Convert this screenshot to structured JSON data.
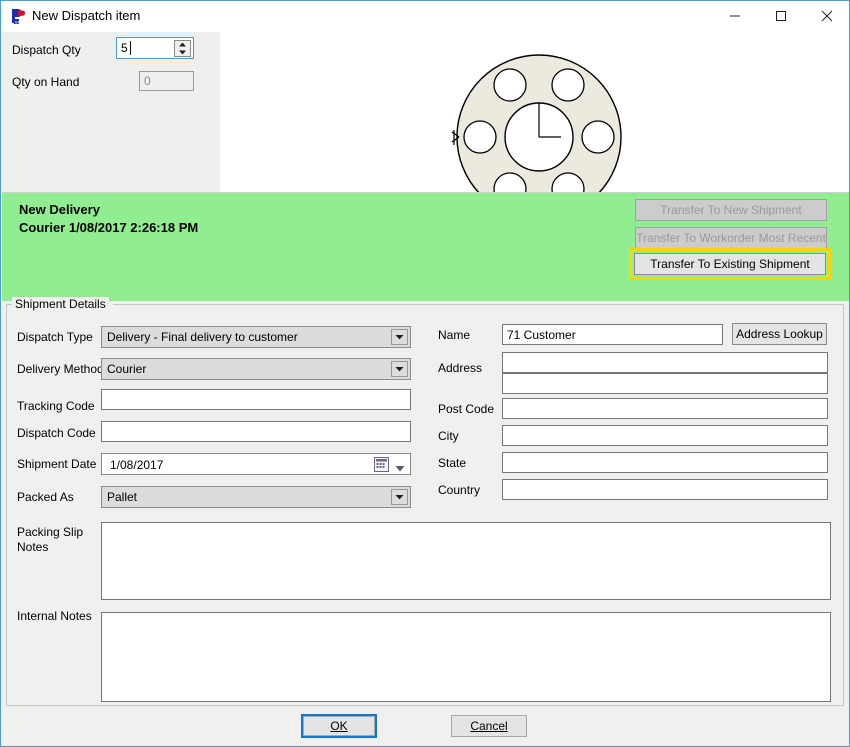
{
  "window": {
    "title": "New Dispatch item",
    "app_icon": "p-logo-icon",
    "controls": {
      "minimize": "minimize-icon",
      "maximize": "maximize-icon",
      "close": "close-icon"
    }
  },
  "top_panel": {
    "dispatch_qty_label": "Dispatch Qty",
    "dispatch_qty_value": "5",
    "qty_on_hand_label": "Qty on Hand",
    "qty_on_hand_value": "0"
  },
  "part_drawing": {
    "name": "flange-part-drawing",
    "description": "Circular flange with six bolt holes and central bore"
  },
  "delivery_banner": {
    "title": "New Delivery",
    "subtitle": "Courier 1/08/2017 2:26:18 PM",
    "background_color": "#90ee90",
    "buttons": [
      {
        "label": "Transfer To New Shipment",
        "enabled": false
      },
      {
        "label": "Transfer To Workorder Most Recent",
        "enabled": false
      },
      {
        "label": "Transfer To Existing Shipment",
        "enabled": true,
        "highlight_color": "#ffd400"
      }
    ]
  },
  "shipment_details": {
    "group_label": "Shipment Details",
    "dispatch_type": {
      "label": "Dispatch Type",
      "value": "Delivery - Final delivery to customer"
    },
    "delivery_method": {
      "label": "Delivery Method",
      "value": "Courier"
    },
    "tracking_code": {
      "label": "Tracking Code",
      "value": ""
    },
    "dispatch_code": {
      "label": "Dispatch Code",
      "value": ""
    },
    "shipment_date": {
      "label": "Shipment Date",
      "value": "1/08/2017"
    },
    "packed_as": {
      "label": "Packed As",
      "value": "Pallet"
    },
    "packing_slip_notes": {
      "label": "Packing Slip Notes",
      "value": ""
    },
    "internal_notes": {
      "label": "Internal Notes",
      "value": ""
    }
  },
  "address": {
    "name": {
      "label": "Name",
      "value": "71 Customer"
    },
    "address_line1": {
      "label": "Address",
      "value": ""
    },
    "address_line2": {
      "label": "",
      "value": ""
    },
    "post_code": {
      "label": "Post Code",
      "value": ""
    },
    "city": {
      "label": "City",
      "value": ""
    },
    "state": {
      "label": "State",
      "value": ""
    },
    "country": {
      "label": "Country",
      "value": ""
    },
    "lookup_button": "Address Lookup"
  },
  "footer": {
    "ok_label": "OK",
    "ok_accesskey": "O",
    "cancel_label": "Cancel",
    "cancel_accesskey": "C"
  }
}
